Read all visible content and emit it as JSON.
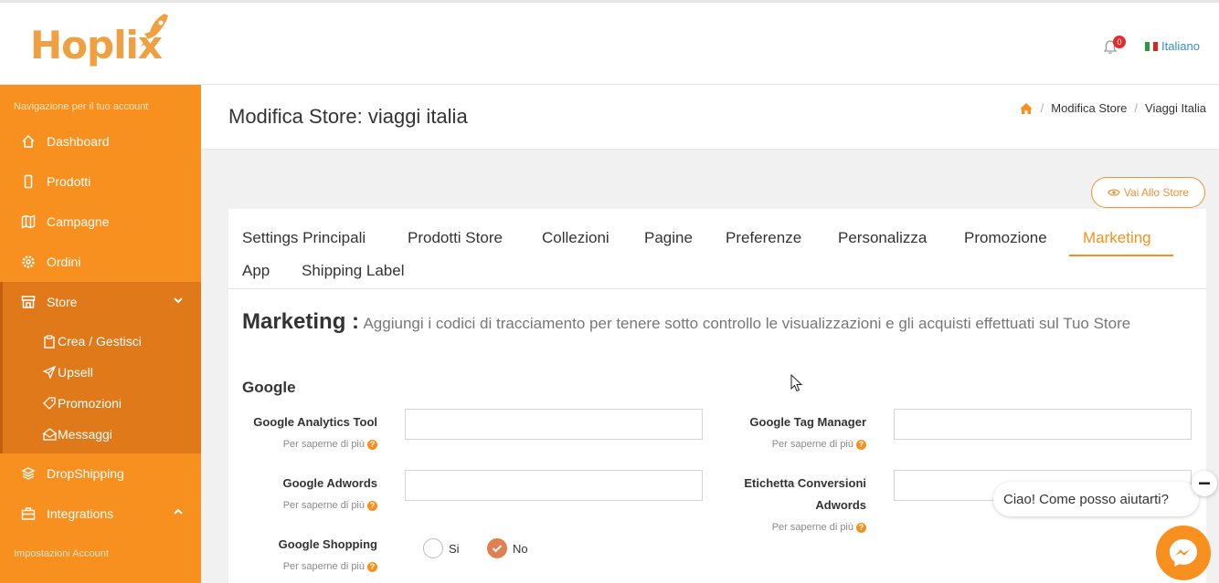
{
  "brand": {
    "logo_text": "Hoplix"
  },
  "header": {
    "notification_count": "0",
    "language": "Italiano"
  },
  "sidebar": {
    "caption": "Navigazione per il tuo account",
    "items": [
      {
        "label": "Dashboard",
        "icon": "home-icon"
      },
      {
        "label": "Prodotti",
        "icon": "phone-icon"
      },
      {
        "label": "Campagne",
        "icon": "map-icon"
      },
      {
        "label": "Ordini",
        "icon": "gear-icon"
      },
      {
        "label": "Store",
        "icon": "store-icon"
      }
    ],
    "store_sub": [
      {
        "label": "Crea / Gestisci",
        "icon": "clipboard-icon"
      },
      {
        "label": "Upsell",
        "icon": "send-icon"
      },
      {
        "label": "Promozioni",
        "icon": "tag-icon"
      },
      {
        "label": "Messaggi",
        "icon": "envelope-icon"
      }
    ],
    "more_items": [
      {
        "label": "DropShipping",
        "icon": "layers-icon"
      },
      {
        "label": "Integrations",
        "icon": "briefcase-icon"
      }
    ],
    "caption_bottom": "Impostazioni Account"
  },
  "page": {
    "title": "Modifica Store: viaggi italia",
    "breadcrumb": [
      "Modifica Store",
      "Viaggi Italia"
    ],
    "visit_button": "Vai Allo Store"
  },
  "tabs": [
    "Settings Principali",
    "Prodotti Store",
    "Collezioni",
    "Pagine",
    "Preferenze",
    "Personalizza",
    "Promozione",
    "Marketing",
    "App",
    "Shipping Label"
  ],
  "active_tab": "Marketing",
  "marketing": {
    "title": "Marketing :",
    "description": "Aggiungi i codici di tracciamento per tenere sotto controllo le visualizzazioni e gli acquisti effettuati sul Tuo Store",
    "group": "Google",
    "help_text": "Per saperne di più",
    "fields": {
      "analytics": {
        "label": "Google Analytics Tool",
        "value": ""
      },
      "tag_manager": {
        "label": "Google Tag Manager",
        "value": ""
      },
      "adwords": {
        "label": "Google Adwords",
        "value": ""
      },
      "conversion_line1": "Etichetta Conversioni",
      "conversion_line2": "Adwords",
      "shopping": {
        "label": "Google Shopping",
        "option_yes": "Si",
        "option_no": "No",
        "selected": "No"
      }
    }
  },
  "chat": {
    "message": "Ciao! Come posso aiutarti?"
  },
  "colors": {
    "accent": "#f7901e",
    "sidebar_active": "#e0791a",
    "link": "#3a8fc9"
  }
}
